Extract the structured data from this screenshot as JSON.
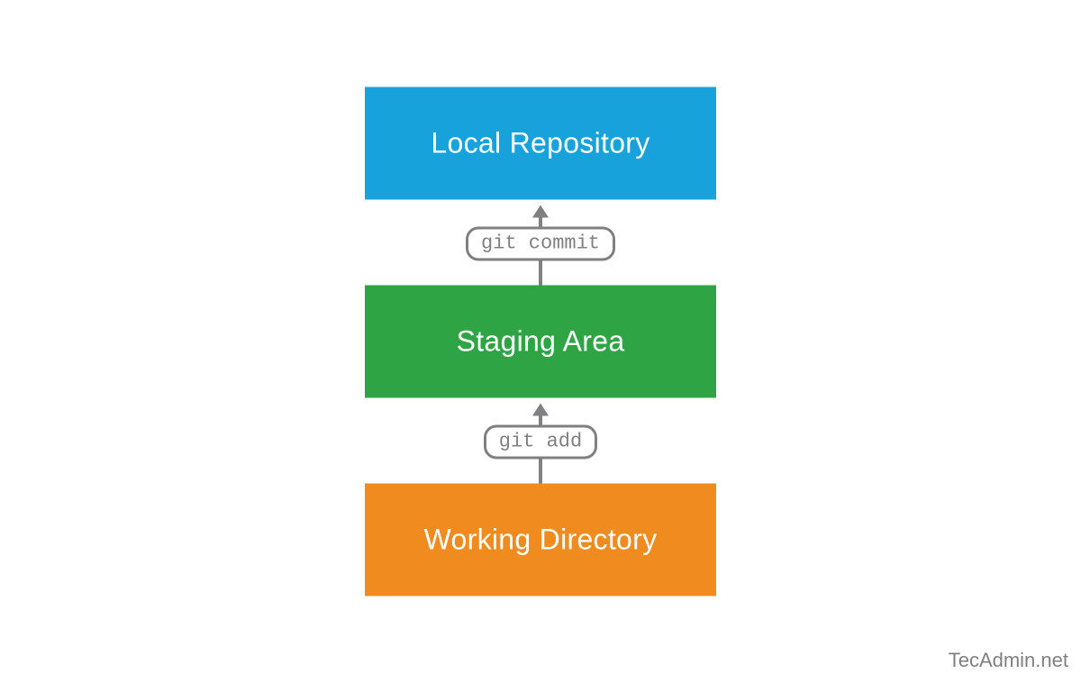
{
  "colors": {
    "box_top": "#17a2db",
    "box_mid": "#2ea444",
    "box_bot": "#f08c1f",
    "arrow": "#808080",
    "pill_text": "#808080",
    "attrib": "#808080"
  },
  "boxes": {
    "top": "Local Repository",
    "mid": "Staging Area",
    "bot": "Working Directory"
  },
  "arrows": {
    "upper_label": "git commit",
    "lower_label": "git add"
  },
  "attribution": "TecAdmin.net"
}
